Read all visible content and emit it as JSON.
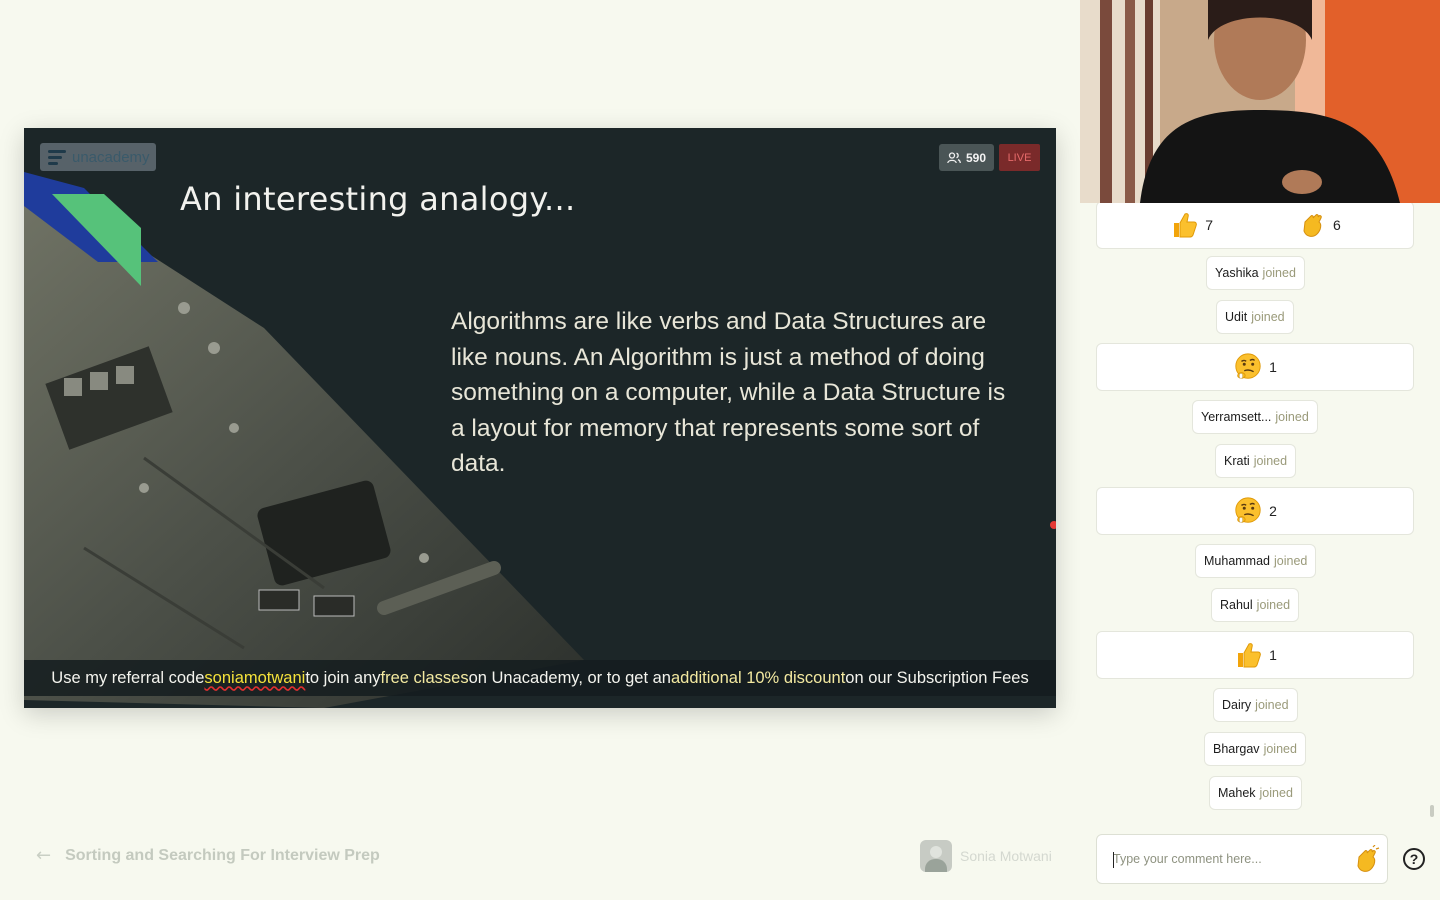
{
  "stage": {
    "logo_text": "unacademy",
    "viewer_count": "590",
    "live_label": "LIVE",
    "slide_title": "An interesting analogy...",
    "slide_body": "Algorithms are like verbs and Data Structures are like nouns. An Algorithm is just a method of doing something on a computer, while a Data Structure is a layout for memory that represents some sort of data.",
    "caption_pre": "Use my referral code ",
    "caption_code": "soniamotwani",
    "caption_mid": " to join any ",
    "caption_hl1": "free classes",
    "caption_mid2": " on Unacademy, or to get an ",
    "caption_hl2": "additional 10% discount",
    "caption_post": " on our Subscription Fees"
  },
  "footer": {
    "course_title": "Sorting and Searching For Interview Prep",
    "educator_name": "Sonia Motwani"
  },
  "feed": {
    "reactions": [
      {
        "items": [
          {
            "icon": "thumbs-up-icon",
            "count": "7"
          },
          {
            "icon": "clap-icon",
            "count": "6"
          }
        ]
      },
      {
        "items": [
          {
            "icon": "thinking-face-icon",
            "count": "1"
          }
        ]
      },
      {
        "items": [
          {
            "icon": "thinking-face-icon",
            "count": "2"
          }
        ]
      },
      {
        "items": [
          {
            "icon": "thumbs-up-icon",
            "count": "1"
          }
        ]
      }
    ],
    "joined_suffix": "joined",
    "joins": [
      "Yashika",
      "Udit",
      "Yerramsett...",
      "Krati",
      "Muhammad",
      "Rahul",
      "Dairy",
      "Bhargav",
      "Mahek"
    ]
  },
  "composer": {
    "placeholder": "Type your comment here...",
    "help_label": "?"
  },
  "colors": {
    "background": "#f7f9ef",
    "slide_bg": "#1c2628",
    "live_red": "#7a2a2a",
    "referral_yellow": "#f5e23a"
  }
}
